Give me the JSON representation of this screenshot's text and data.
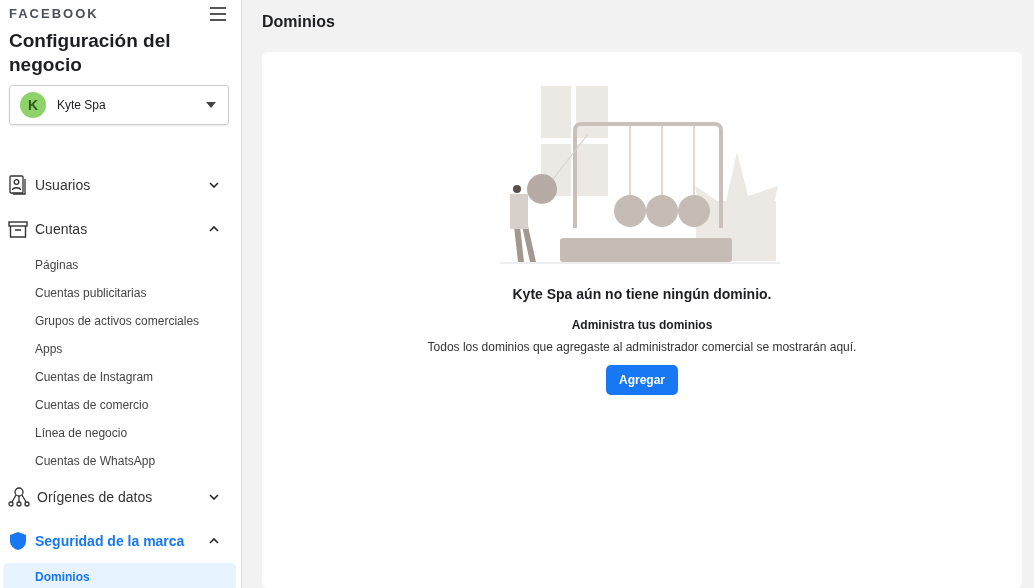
{
  "sidebar": {
    "brand": "FACEBOOK",
    "title": "Configuración del negocio",
    "account": {
      "initial": "K",
      "name": "Kyte Spa"
    },
    "sections": [
      {
        "label": "Usuarios",
        "expanded": false,
        "selected": false
      },
      {
        "label": "Cuentas",
        "expanded": true,
        "selected": false,
        "children": [
          {
            "label": "Páginas",
            "selected": false
          },
          {
            "label": "Cuentas publicitarias",
            "selected": false
          },
          {
            "label": "Grupos de activos comerciales",
            "selected": false
          },
          {
            "label": "Apps",
            "selected": false
          },
          {
            "label": "Cuentas de Instagram",
            "selected": false
          },
          {
            "label": "Cuentas de comercio",
            "selected": false
          },
          {
            "label": "Línea de negocio",
            "selected": false
          },
          {
            "label": "Cuentas de WhatsApp",
            "selected": false
          }
        ]
      },
      {
        "label": "Orígenes de datos",
        "expanded": false,
        "selected": false
      },
      {
        "label": "Seguridad de la marca",
        "expanded": true,
        "selected": true,
        "children": [
          {
            "label": "Dominios",
            "selected": true
          }
        ]
      }
    ]
  },
  "page_title": "Dominios",
  "empty_state": {
    "heading": "Kyte Spa aún no tiene ningún dominio.",
    "subheading": "Administra tus dominios",
    "description": "Todos los dominios que agregaste al administrador comercial se mostrarán aquí.",
    "button": "Agregar"
  }
}
